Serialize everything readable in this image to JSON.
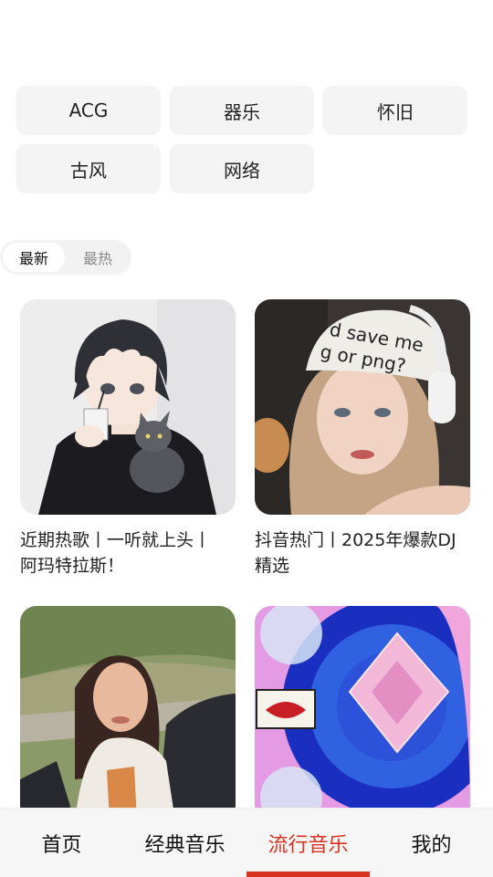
{
  "categories": [
    "ACG",
    "器乐",
    "怀旧",
    "古风",
    "网络"
  ],
  "sort_toggle": {
    "options": [
      "最新",
      "最热"
    ],
    "selected": "最新"
  },
  "playlists": [
    {
      "title": "近期热歌丨一听就上头丨\n阿玛特拉斯！",
      "cover": "anime-boy-cover"
    },
    {
      "title": "抖音热门丨2025年爆款DJ\n精选",
      "cover": "girl-headphones-cover"
    },
    {
      "title": "",
      "cover": "girl-by-car-cover"
    },
    {
      "title": "",
      "cover": "vinyl-album-cover"
    }
  ],
  "covers": {
    "headphone_cap_text_line1": "d save me",
    "headphone_cap_text_line2": "g or png?"
  },
  "tabbar": {
    "tabs": [
      "首页",
      "经典音乐",
      "流行音乐",
      "我的"
    ],
    "active": "流行音乐",
    "active_color": "#d9321f"
  }
}
